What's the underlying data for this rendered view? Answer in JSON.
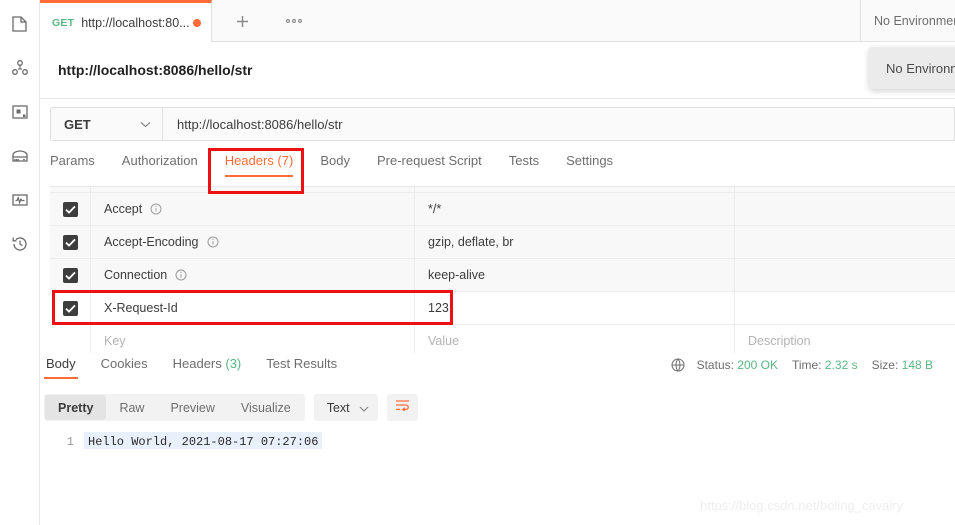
{
  "sidebar": {
    "items": [
      {
        "name": "collections-icon",
        "label": "Collections"
      },
      {
        "name": "apis-icon",
        "label": "APIs"
      },
      {
        "name": "environments-icon",
        "label": "Environments"
      },
      {
        "name": "mock-servers-icon",
        "label": "Mock Servers"
      },
      {
        "name": "monitors-icon",
        "label": "Monitors"
      },
      {
        "name": "history-icon",
        "label": "History"
      }
    ]
  },
  "tabbar": {
    "tab": {
      "method": "GET",
      "title": "http://localhost:80...",
      "unsaved_indicator": "unsaved-dot"
    },
    "new_tab_label": "+",
    "more_label": "●●●",
    "environment_selected": "No Environment",
    "environment_popup": "No Environment"
  },
  "request": {
    "name": "http://localhost:8086/hello/str",
    "method": "GET",
    "url": "http://localhost:8086/hello/str",
    "tabs": [
      {
        "label": "Params",
        "active": false
      },
      {
        "label": "Authorization",
        "active": false
      },
      {
        "label": "Headers (7)",
        "active": true
      },
      {
        "label": "Body",
        "active": false
      },
      {
        "label": "Pre-request Script",
        "active": false
      },
      {
        "label": "Tests",
        "active": false
      },
      {
        "label": "Settings",
        "active": false
      }
    ],
    "headers_table": {
      "columns": [
        "Key",
        "Value",
        "Description"
      ],
      "placeholders": {
        "key": "Key",
        "value": "Value",
        "description": "Description"
      },
      "rows": [
        {
          "checked": true,
          "key": "Accept",
          "info": true,
          "value": "*/*",
          "description": ""
        },
        {
          "checked": true,
          "key": "Accept-Encoding",
          "info": true,
          "value": "gzip, deflate, br",
          "description": ""
        },
        {
          "checked": true,
          "key": "Connection",
          "info": true,
          "value": "keep-alive",
          "description": ""
        },
        {
          "checked": true,
          "key": "X-Request-Id",
          "info": false,
          "value": "123",
          "description": ""
        }
      ]
    }
  },
  "response": {
    "tabs": [
      {
        "label": "Body",
        "count": "",
        "active": true
      },
      {
        "label": "Cookies",
        "count": "",
        "active": false
      },
      {
        "label": "Headers",
        "count": "(3)",
        "active": false
      },
      {
        "label": "Test Results",
        "count": "",
        "active": false
      }
    ],
    "meta": {
      "status_label": "Status:",
      "status_value": "200 OK",
      "time_label": "Time:",
      "time_value": "2.32 s",
      "size_label": "Size:",
      "size_value": "148 B"
    },
    "view_modes": [
      {
        "label": "Pretty",
        "active": true
      },
      {
        "label": "Raw",
        "active": false
      },
      {
        "label": "Preview",
        "active": false
      },
      {
        "label": "Visualize",
        "active": false
      }
    ],
    "format": "Text",
    "wrap_icon": "word-wrap-icon",
    "body": {
      "line_number": "1",
      "text": "Hello World, 2021-08-17 07:27:06"
    }
  },
  "watermark": "https://blog.csdn.net/boling_cavalry",
  "colors": {
    "accent": "#ff6c37",
    "green": "#5ab782",
    "annotation": "#ee1111",
    "checkbox": "#3d3d3d"
  }
}
